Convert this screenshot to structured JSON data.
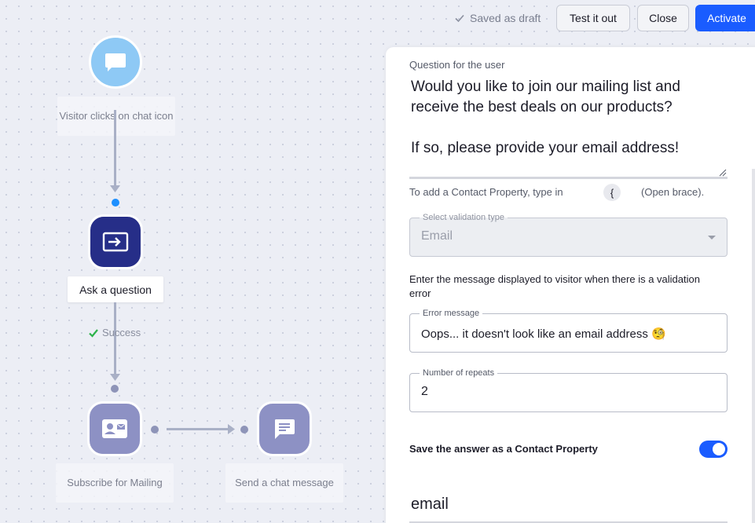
{
  "topbar": {
    "saved_status": "Saved as draft",
    "test_label": "Test it out",
    "close_label": "Close",
    "activate_label": "Activate"
  },
  "flow": {
    "trigger_label": "Visitor clicks on chat icon",
    "question_label": "Ask a question",
    "success_label": "Success",
    "subscribe_label": "Subscribe for Mailing",
    "send_label": "Send a chat message"
  },
  "panel": {
    "question_field_label": "Question for the user",
    "question_text": "Would you like to join our mailing list and receive the best deals on our products?\n\nIf so, please provide your email address!",
    "hint_prefix": "To add a Contact Property, type in",
    "hint_brace": "{",
    "hint_suffix": "(Open brace).",
    "validation_legend": "Select validation type",
    "validation_value": "Email",
    "validation_desc": "Enter the message displayed to visitor when there is a validation error",
    "error_legend": "Error message",
    "error_value": "Oops... it doesn't look like an email address 🧐",
    "repeats_legend": "Number of repeats",
    "repeats_value": "2",
    "save_toggle_label": "Save the answer as a Contact Property",
    "save_toggle_on": true,
    "contact_property_value": "email"
  },
  "colors": {
    "primary": "#1a5cff",
    "trigger_node": "#8ec9f5",
    "active_node": "#262e88",
    "inactive_node": "#8d91c4"
  }
}
